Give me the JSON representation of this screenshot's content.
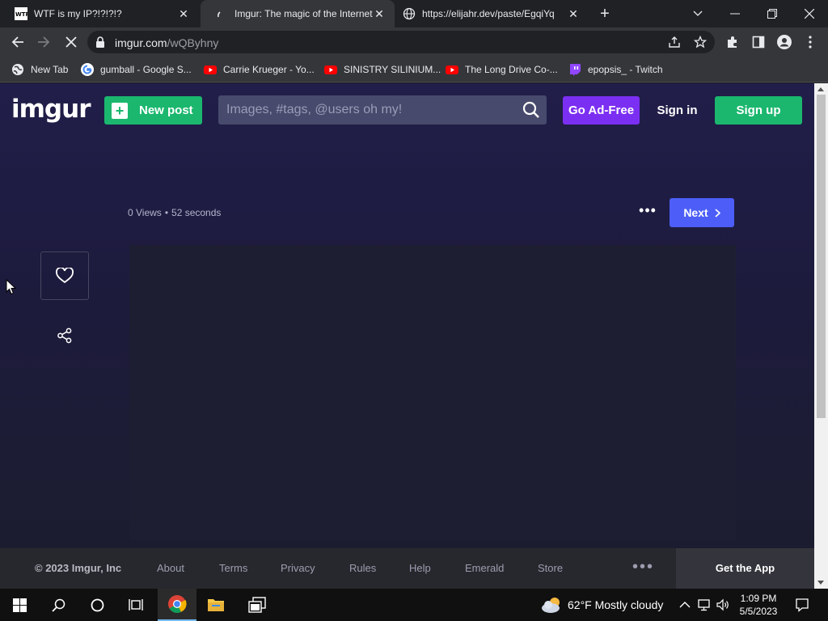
{
  "browser": {
    "tabs": [
      {
        "title": "WTF is my IP?!?!?!?",
        "close": "✕",
        "favicon": "wtf-icon"
      },
      {
        "title": "Imgur: The magic of the Internet",
        "close": "✕",
        "favicon": "loading-icon",
        "active": true
      },
      {
        "title": "https://elijahr.dev/paste/EgqiYq",
        "close": "✕",
        "favicon": "globe-icon"
      }
    ],
    "new_tab": "+",
    "wtf_badge": "WTF",
    "url_host": "imgur.com",
    "url_path": "/wQByhny",
    "bookmarks": [
      {
        "label": "New Tab",
        "icon": "globe-icon"
      },
      {
        "label": "gumball - Google S...",
        "icon": "google-icon"
      },
      {
        "label": "Carrie Krueger - Yo...",
        "icon": "youtube-icon"
      },
      {
        "label": "SINISTRY SILINIUM...",
        "icon": "youtube-icon"
      },
      {
        "label": "The Long Drive Co-...",
        "icon": "youtube-icon"
      },
      {
        "label": "epopsis_ - Twitch",
        "icon": "twitch-icon"
      }
    ]
  },
  "imgur": {
    "logo": "imgur",
    "new_post": "New post",
    "search_placeholder": "Images, #tags, @users oh my!",
    "go_ad_free": "Go Ad-Free",
    "sign_in": "Sign in",
    "sign_up": "Sign up",
    "views": "0 Views",
    "dot": "•",
    "age": "52 seconds",
    "more": "•••",
    "next": "Next"
  },
  "footer": {
    "copyright": "© 2023 Imgur, Inc",
    "links": [
      "About",
      "Terms",
      "Privacy",
      "Rules",
      "Help",
      "Emerald",
      "Store"
    ],
    "more": "•••",
    "get_app": "Get the App"
  },
  "taskbar": {
    "weather": "62°F  Mostly cloudy",
    "time": "1:09 PM",
    "date": "5/5/2023"
  },
  "colors": {
    "imgur_green": "#1bb76e",
    "ad_free_purple": "#7b2ff2",
    "next_blue": "#4c5ef7"
  }
}
